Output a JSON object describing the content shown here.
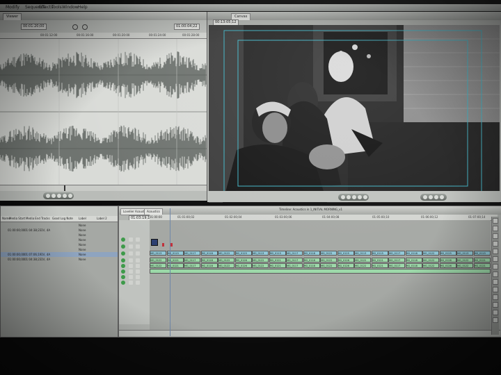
{
  "menu": {
    "items": [
      "Modify",
      "Sequence",
      "Effects",
      "Tools",
      "Window",
      "Help"
    ]
  },
  "viewer": {
    "tab_label": "Viewer",
    "timecode_left": "00:01:20;00",
    "timecode_right": "01:00:04;22",
    "ruler_ticks": [
      "00:01:12:00",
      "00:01:16:00",
      "00:01:20:00",
      "00:01:24:00",
      "00:01:28:00"
    ]
  },
  "canvas": {
    "tab_label": "Canvas",
    "timecode_left": "00:13:05;12",
    "timecode_right": "01:03:19;22"
  },
  "browser": {
    "columns": [
      "Name",
      "Media Start",
      "Media End",
      "Tracks",
      "Good",
      "Log Note",
      "Label",
      "Label 2"
    ],
    "rows": [
      {
        "a": "",
        "b": "",
        "c": "",
        "d": "None"
      },
      {
        "a": "01:00:00;00",
        "b": "01:04:38;23",
        "c": "1V, 4A",
        "d": "None"
      },
      {
        "a": "",
        "b": "",
        "c": "",
        "d": "None"
      },
      {
        "a": "",
        "b": "",
        "c": "",
        "d": "None"
      },
      {
        "a": "",
        "b": "",
        "c": "",
        "d": "None"
      },
      {
        "a": "",
        "b": "",
        "c": "",
        "d": "None"
      },
      {
        "a": "01:00:00;00",
        "b": "01:07:06;19",
        "c": "1V, 4A",
        "d": "None"
      },
      {
        "a": "01:00:00;00",
        "b": "01:04:38;23",
        "c": "1V, 4A",
        "d": "None"
      }
    ]
  },
  "timeline": {
    "tab_1": "Lovelier Acoustics",
    "tab_2": "Acoustics",
    "sequence_title": "Timeline: Acoustics in 1_INITIAL MORNING_v1",
    "current_timecode": "01:03:19;19",
    "ruler_ticks": [
      "01:00:00",
      "01:01:00;02",
      "01:02:00;04",
      "01:03:00;06",
      "01:04:00;08",
      "01:05:00;10",
      "01:06:00;12",
      "01:07:00;14"
    ],
    "v1_clip_label": "MG_0113",
    "a_clip_label": "MG_0122",
    "v1_clips": [
      "MG_0113",
      "MG_0115",
      "MG_0117",
      "MG_0118",
      "MG_0122",
      "MG_0125"
    ],
    "a_clips": [
      "MG_0122",
      "MG_0121",
      "MG_0117",
      "MG_0118",
      "MG_0122",
      "MG_0126"
    ]
  },
  "colors": {
    "video_clip": "#8fc7d6",
    "audio_clip": "#9bd8a8",
    "waveform": "#6f7470"
  }
}
